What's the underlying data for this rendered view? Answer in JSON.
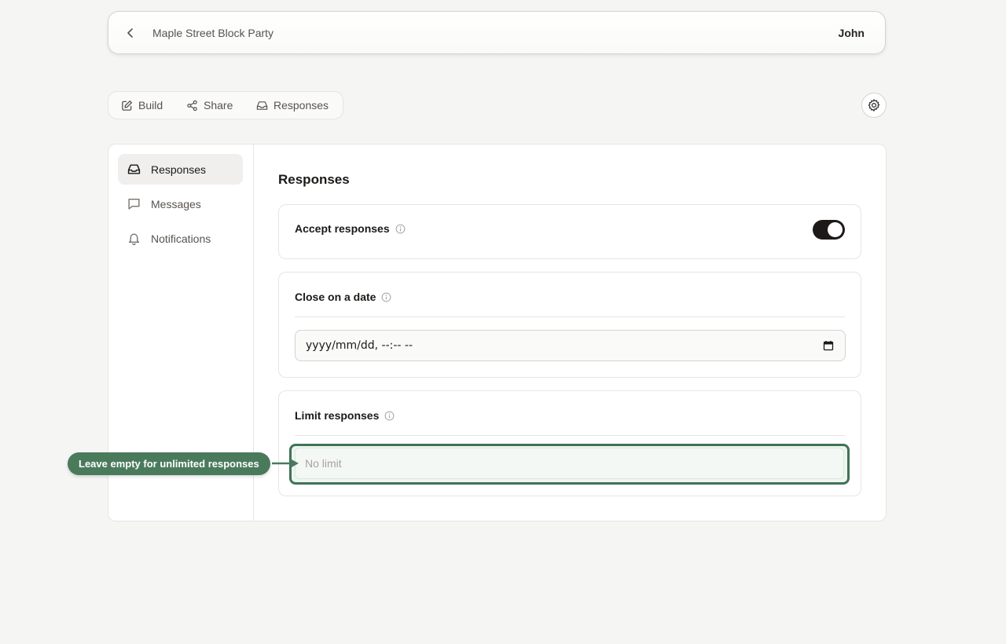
{
  "header": {
    "back_icon": "chevron-left-icon",
    "form_title": "Maple Street Block Party",
    "user_name": "John"
  },
  "tabs": [
    {
      "label": "Build",
      "icon": "edit-icon"
    },
    {
      "label": "Share",
      "icon": "share-icon"
    },
    {
      "label": "Responses",
      "icon": "inbox-icon"
    }
  ],
  "settings_icon": "gear-icon",
  "sidebar": {
    "items": [
      {
        "label": "Responses",
        "icon": "inbox-icon",
        "active": true
      },
      {
        "label": "Messages",
        "icon": "message-icon",
        "active": false
      },
      {
        "label": "Notifications",
        "icon": "bell-icon",
        "active": false
      }
    ]
  },
  "content": {
    "title": "Responses",
    "accept": {
      "label": "Accept responses",
      "enabled": true
    },
    "close_date": {
      "label": "Close on a date",
      "value": "yyyy/mm/dd, --:-- --"
    },
    "limit": {
      "label": "Limit responses",
      "placeholder": "No limit",
      "value": ""
    }
  },
  "hint": {
    "text": "Leave empty for unlimited responses"
  },
  "colors": {
    "accent_green": "#4a7a5c",
    "highlight_border": "#3f7355",
    "toggle_on": "#1c1917",
    "background": "#f5f5f4"
  }
}
